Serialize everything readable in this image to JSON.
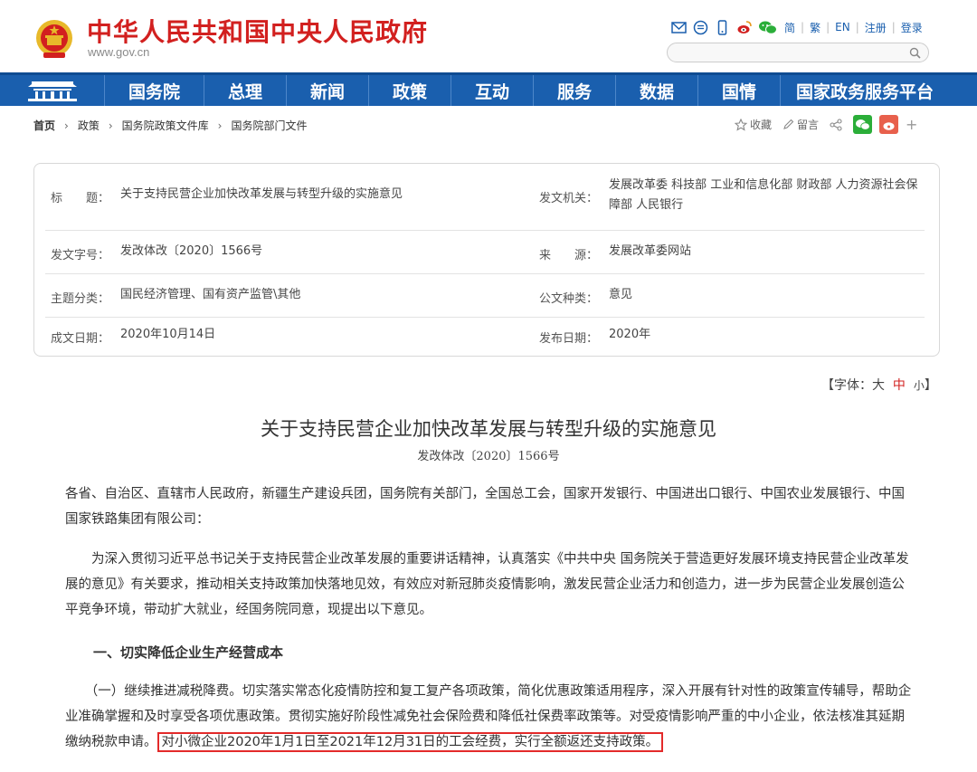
{
  "header": {
    "site_title": "中华人民共和国中央人民政府",
    "site_url": "www.gov.cn",
    "lang_simplified": "简",
    "lang_traditional": "繁",
    "lang_en": "EN",
    "register": "注册",
    "login": "登录",
    "brand_red": "#d2201f",
    "nav_blue": "#1a5fae"
  },
  "nav": {
    "items": [
      "国务院",
      "总理",
      "新闻",
      "政策",
      "互动",
      "服务",
      "数据",
      "国情",
      "国家政务服务平台"
    ]
  },
  "breadcrumb": {
    "items": [
      "首页",
      "政策",
      "国务院政策文件库",
      "国务院部门文件"
    ]
  },
  "share": {
    "favorite": "收藏",
    "comment": "留言",
    "plus": "+"
  },
  "info": {
    "title_label": "标　　题：",
    "title_value": "关于支持民营企业加快改革发展与转型升级的实施意见",
    "issuer_label": "发文机关：",
    "issuer_value": "发展改革委  科技部  工业和信息化部  财政部  人力资源社会保障部  人民银行",
    "docno_label": "发文字号：",
    "docno_value": "发改体改〔2020〕1566号",
    "source_label": "来　　源：",
    "source_value": "发展改革委网站",
    "topic_label": "主题分类：",
    "topic_value": "国民经济管理、国有资产监管\\其他",
    "doctype_label": "公文种类：",
    "doctype_value": "意见",
    "written_label": "成文日期：",
    "written_value": "2020年10月14日",
    "published_label": "发布日期：",
    "published_value": "2020年"
  },
  "fontsize": {
    "prefix": "【字体：",
    "large": "大",
    "medium": "中",
    "small": "小",
    "suffix": "】"
  },
  "article": {
    "title": "关于支持民营企业加快改革发展与转型升级的实施意见",
    "doc_no": "发改体改〔2020〕1566号",
    "p1": "各省、自治区、直辖市人民政府，新疆生产建设兵团，国务院有关部门，全国总工会，国家开发银行、中国进出口银行、中国农业发展银行、中国国家铁路集团有限公司：",
    "p2": "　　为深入贯彻习近平总书记关于支持民营企业改革发展的重要讲话精神，认真落实《中共中央 国务院关于营造更好发展环境支持民营企业改革发展的意见》有关要求，推动相关支持政策加快落地见效，有效应对新冠肺炎疫情影响，激发民营企业活力和创造力，进一步为民营企业发展创造公平竞争环境，带动扩大就业，经国务院同意，现提出以下意见。",
    "section1": "一、切实降低企业生产经营成本",
    "p3": "　　（一）继续推进减税降费。切实落实常态化疫情防控和复工复产各项政策，简化优惠政策适用程序，深入开展有针对性的政策宣传辅导，帮助企业准确掌握和及时享受各项优惠政策。贯彻实施好阶段性减免社会保险费和降低社保费率政策等。对受疫情影响严重的中小企业，依法核准其延期缴纳税款申请。",
    "p3_highlight": "对小微企业2020年1月1日至2021年12月31日的工会经费，实行全额返还支持政策。"
  }
}
